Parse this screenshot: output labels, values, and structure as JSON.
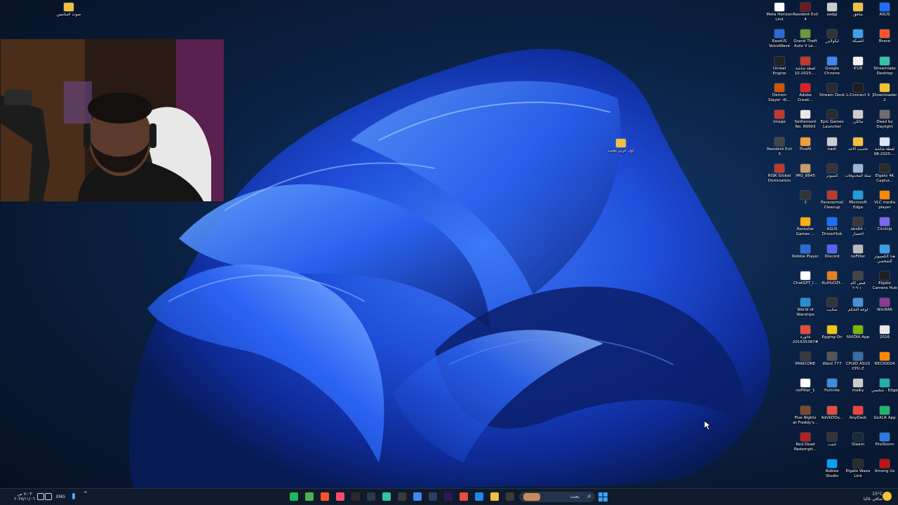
{
  "desktop": {
    "left_icon": {
      "label": "صوت المتابعين",
      "icon": "folder-icon"
    },
    "center_icon": {
      "label": "اول عربي يجيب ...",
      "icon": "folder-icon"
    },
    "icons": [
      {
        "label": "ASUS",
        "color": "#1e6fff"
      },
      {
        "label": "Brave",
        "color": "#fb542b"
      },
      {
        "label": "Streamlabs Desktop",
        "color": "#31c3a2"
      },
      {
        "label": "JDownloader 2",
        "color": "#f2c230"
      },
      {
        "label": "Dead by Daylight",
        "color": "#6d6d6d"
      },
      {
        "label": "لقطة شاشة 2025-08-...",
        "color": "#d9e6f5"
      },
      {
        "label": "Elgato 4K Captur...",
        "color": "#2b2b2b"
      },
      {
        "label": "VLC media player",
        "color": "#ff8800"
      },
      {
        "label": "ClickUp",
        "color": "#7b68ee"
      },
      {
        "label": "هذا الكمبيوتر الشخصي",
        "color": "#3aa0e8"
      },
      {
        "label": "Elgato Camera Hub",
        "color": "#1f1f1f"
      },
      {
        "label": "WinRAR",
        "color": "#8b3a8f"
      },
      {
        "label": "2016",
        "color": "#e8e8e8"
      },
      {
        "label": "REC00004",
        "color": "#ff8800"
      },
      {
        "label": "شخصي - Edge",
        "color": "#1fb0a6"
      },
      {
        "label": "GoXLR App",
        "color": "#24b36b"
      },
      {
        "label": "FireStorm",
        "color": "#2d7be0"
      },
      {
        "label": "Among Us",
        "color": "#c51111"
      },
      {
        "label": "منافق",
        "color": "#f0c040"
      },
      {
        "label": "الشبكة",
        "color": "#3aa0e8"
      },
      {
        "label": "iCUE",
        "color": "#f2f2f2"
      },
      {
        "label": "L-Connect 3",
        "color": "#1d1d1d"
      },
      {
        "label": "مالكي",
        "color": "#cccccc"
      },
      {
        "label": "تحديث الاحد",
        "color": "#f0c040"
      },
      {
        "label": "سلة المحذوفات",
        "color": "#9fb5d0"
      },
      {
        "label": "Microsoft Edge",
        "color": "#1fa0d8"
      },
      {
        "label": "obs64 - اختصار",
        "color": "#3a3a3a"
      },
      {
        "label": "noFilter",
        "color": "#bbbbbb"
      },
      {
        "label": "فيس كام ١٠-٩-٢",
        "color": "#444444"
      },
      {
        "label": "لوحة التحكم",
        "color": "#4a90d9"
      },
      {
        "label": "NVIDIA App",
        "color": "#76b900"
      },
      {
        "label": "CPUID ASUS CPU-Z",
        "color": "#3a6ea5"
      },
      {
        "label": "malky",
        "color": "#cccccc"
      },
      {
        "label": "AnyDesk",
        "color": "#ef443b"
      },
      {
        "label": "Steam",
        "color": "#1b2838"
      },
      {
        "label": "Elgato Wave Link",
        "color": "#2b2b2b"
      },
      {
        "label": "sedgi",
        "color": "#cccccc"
      },
      {
        "label": "ايكولايزر",
        "color": "#333333"
      },
      {
        "label": "Google Chrome",
        "color": "#4285f4"
      },
      {
        "label": "Stream Deck",
        "color": "#2b2b2b"
      },
      {
        "label": "Epic Games Launcher",
        "color": "#2a2a2a"
      },
      {
        "label": "nadr",
        "color": "#cccccc"
      },
      {
        "label": "كمبيوتر",
        "color": "#333333"
      },
      {
        "label": "Paranormal Cleanup",
        "color": "#c0392b"
      },
      {
        "label": "ASUS DriverHub",
        "color": "#1e6fff"
      },
      {
        "label": "Discord",
        "color": "#5865f2"
      },
      {
        "label": "-KuIHsOZf...",
        "color": "#e67e22"
      },
      {
        "label": "ستايب",
        "color": "#333333"
      },
      {
        "label": "Egging On",
        "color": "#f1c40f"
      },
      {
        "label": "Ward 777",
        "color": "#555555"
      },
      {
        "label": "Fortnite",
        "color": "#3c8ce7"
      },
      {
        "label": "AdVkDOy...",
        "color": "#e74c3c"
      },
      {
        "label": "جنيت",
        "color": "#333333"
      },
      {
        "label": "Roblox Studio",
        "color": "#00a2ff"
      },
      {
        "label": "Resident Evil 4",
        "color": "#6b1b1b"
      },
      {
        "label": "Grand Theft Auto V Le...",
        "color": "#6a9a3a"
      },
      {
        "label": "لقطة شاشة 2025-10-...",
        "color": "#c0392b"
      },
      {
        "label": "Adobe Creati...",
        "color": "#da1f26"
      },
      {
        "label": "Settlement No. 89993",
        "color": "#e8e8e8"
      },
      {
        "label": "FiveM",
        "color": "#f29b38"
      },
      {
        "label": "IMG_8845",
        "color": "#c89a6a"
      },
      {
        "label": "2",
        "color": "#333333"
      },
      {
        "label": "Rockstar Games ...",
        "color": "#fcaf17"
      },
      {
        "label": "Roblox Player",
        "color": "#2b6bd8"
      },
      {
        "label": "ChatGPT_I...",
        "color": "#ffffff"
      },
      {
        "label": "World of Warships",
        "color": "#2a8fd0"
      },
      {
        "label": "فاتورة #201635387",
        "color": "#e74c3c"
      },
      {
        "label": "PANICORE",
        "color": "#3a3a3a"
      },
      {
        "label": "noFilter_1",
        "color": "#ffffff"
      },
      {
        "label": "Five Nights at Freddy's...",
        "color": "#7a4a2a"
      },
      {
        "label": "Red Dead Redempti...",
        "color": "#b22222"
      },
      {
        "label": "Meta Horizon Link",
        "color": "#ffffff"
      },
      {
        "label": "EaseUS VoiceWave",
        "color": "#2b6bd8"
      },
      {
        "label": "Unreal Engine",
        "color": "#222222"
      },
      {
        "label": "Demon Slayer -Ki...",
        "color": "#d35400"
      },
      {
        "label": "image",
        "color": "#c0392b"
      },
      {
        "label": "Resident Evil 3",
        "color": "#444444"
      },
      {
        "label": "RISK Global Domination",
        "color": "#c0392b"
      }
    ]
  },
  "taskbar": {
    "tray_left": {
      "time": "٧:٠٣ ص",
      "date": "٢٠٢٥/١١/٠٦",
      "lang": "ENG"
    },
    "search_placeholder": "بحث",
    "weather": {
      "temp": "15°C",
      "desc": "صافي غالبا"
    },
    "apps": [
      {
        "name": "app-green",
        "color": "#1db954"
      },
      {
        "name": "app-chrome",
        "color": "#4caf50"
      },
      {
        "name": "app-brave",
        "color": "#fb542b"
      },
      {
        "name": "app-youtube",
        "color": "#ff4a6a"
      },
      {
        "name": "app-capcut",
        "color": "#2a2a2a"
      },
      {
        "name": "app-davinci",
        "color": "#2a3a4a"
      },
      {
        "name": "app-streamlabs",
        "color": "#31c3a2"
      },
      {
        "name": "app-obs",
        "color": "#3a3a3a"
      },
      {
        "name": "app-google-chrome",
        "color": "#4285f4"
      },
      {
        "name": "app-store",
        "color": "#2b3f5c"
      },
      {
        "name": "app-premiere",
        "color": "#2a1a5a"
      },
      {
        "name": "app-acrobat",
        "color": "#e74c3c"
      },
      {
        "name": "app-photos",
        "color": "#1e88e5"
      },
      {
        "name": "app-explorer",
        "color": "#f0c040"
      },
      {
        "name": "app-terminal",
        "color": "#3a3a3a"
      }
    ]
  }
}
